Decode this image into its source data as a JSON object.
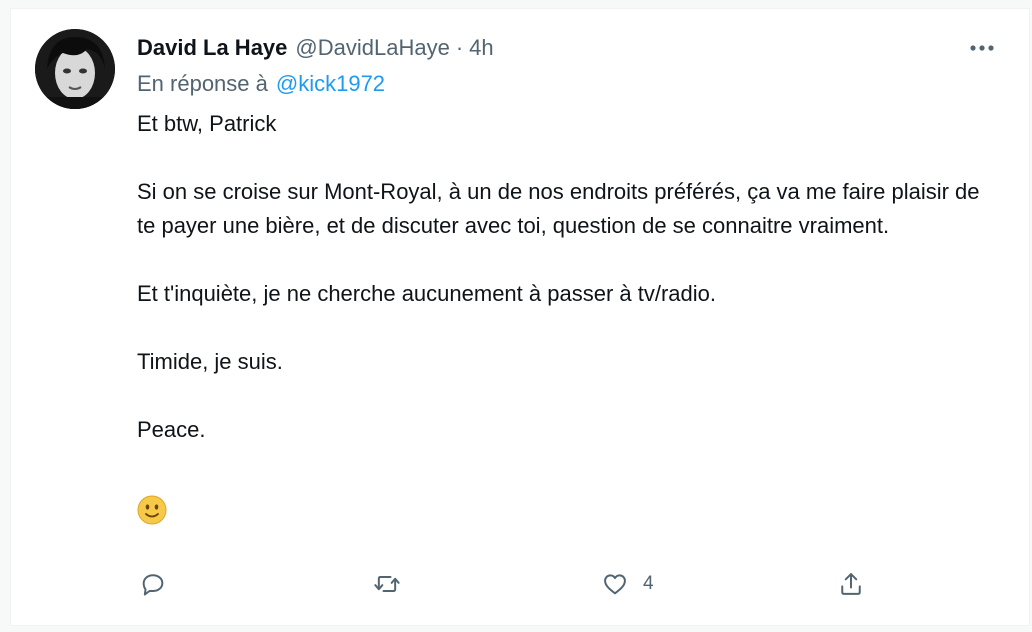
{
  "tweet": {
    "author_name": "David La Haye",
    "author_handle": "@DavidLaHaye",
    "separator": "·",
    "time": "4h",
    "reply_prefix": "En réponse à",
    "reply_to": "@kick1972",
    "paragraphs": [
      "Et btw, Patrick",
      "Si on se croise sur Mont-Royal, à un de nos endroits préférés, ça va me faire plaisir de te payer une bière, et de discuter avec toi, question de se connaitre vraiment.",
      "Et t'inquiète, je ne cherche aucunement à passer à tv/radio.",
      "Timide, je suis.",
      "Peace."
    ],
    "emoji": "🙂",
    "like_count": "4"
  },
  "icons": {
    "more": "more-horizontal-icon",
    "reply": "reply-bubble-icon",
    "retweet": "retweet-icon",
    "like": "heart-icon",
    "share": "share-icon"
  },
  "colors": {
    "text": "#0f1419",
    "secondary": "#536471",
    "link": "#1d9bf0",
    "emoji": "#f7c948"
  }
}
